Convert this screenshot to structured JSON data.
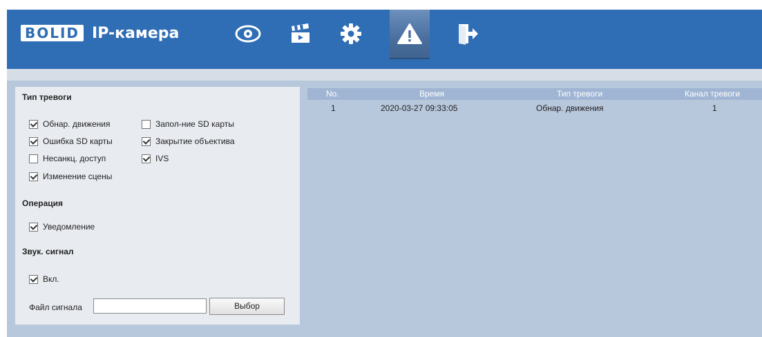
{
  "header": {
    "logo_text": "BOLID",
    "title": "IP-камера",
    "nav": [
      "eye-icon",
      "clapperboard-icon",
      "gear-icon",
      "warning-icon",
      "exit-icon"
    ],
    "active": "warning-icon",
    "colors": {
      "bar": "#2f6db5",
      "content": "#b7c7dc"
    }
  },
  "alarm_type": {
    "title": "Тип тревоги",
    "items": [
      {
        "label": "Обнар. движения",
        "checked": true
      },
      {
        "label": "Запол-ние SD карты",
        "checked": false
      },
      {
        "label": "Ошибка SD карты",
        "checked": true
      },
      {
        "label": "Закрытие объектива",
        "checked": true
      },
      {
        "label": "Несанкц. доступ",
        "checked": false
      },
      {
        "label": "IVS",
        "checked": true
      },
      {
        "label": "Изменение сцены",
        "checked": true
      }
    ]
  },
  "operation": {
    "title": "Операция",
    "items": [
      {
        "label": "Уведомление",
        "checked": true
      }
    ]
  },
  "sound": {
    "title": "Звук. сигнал",
    "items": [
      {
        "label": "Вкл.",
        "checked": true
      }
    ],
    "file_label": "Файл сигнала",
    "file_value": "",
    "select_button": "Выбор"
  },
  "table": {
    "columns": [
      "No.",
      "Время",
      "Тип тревоги",
      "Канал тревоги"
    ],
    "rows": [
      [
        "1",
        "2020-03-27 09:33:05",
        "Обнар. движения",
        "1"
      ]
    ]
  }
}
